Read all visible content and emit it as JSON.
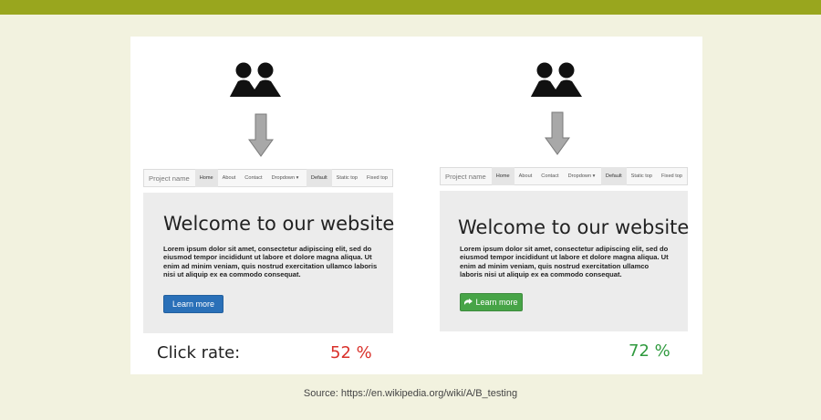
{
  "icons": {
    "users": "users-icon",
    "arrow": "arrow-down-icon",
    "button_arrow": "arrow-right-icon"
  },
  "colors": {
    "header_bar": "#99a61e",
    "background": "#f2f2df",
    "blue_button": "#2a70b8",
    "green_button": "#47a447",
    "rate_a": "#d9302a",
    "rate_b": "#2f9a3e"
  },
  "variant_a": {
    "navbar": {
      "brand": "Project name",
      "items": [
        "Home",
        "About",
        "Contact",
        "Dropdown ▾"
      ],
      "right_items": [
        "Default",
        "Static top",
        "Fixed top"
      ]
    },
    "title": "Welcome to our website",
    "text": "Lorem ipsum dolor sit amet, consectetur adipiscing elit, sed do eiusmod tempor incididunt ut labore et dolore magna aliqua. Ut enim ad minim veniam, quis nostrud exercitation ullamco laboris nisi ut aliquip ex ea commodo consequat.",
    "button_label": "Learn more",
    "click_rate": "52 %"
  },
  "variant_b": {
    "navbar": {
      "brand": "Project name",
      "items": [
        "Home",
        "About",
        "Contact",
        "Dropdown ▾"
      ],
      "right_items": [
        "Default",
        "Static top",
        "Fixed top"
      ]
    },
    "title": "Welcome to our website",
    "text": "Lorem ipsum dolor sit amet, consectetur adipiscing elit, sed do eiusmod tempor incididunt ut labore et dolore magna aliqua. Ut enim ad minim veniam, quis nostrud exercitation ullamco laboris nisi ut aliquip ex ea commodo consequat.",
    "button_label": "Learn more",
    "click_rate": "72 %"
  },
  "click_rate_label": "Click rate:",
  "source": "Source: https://en.wikipedia.org/wiki/A/B_testing"
}
